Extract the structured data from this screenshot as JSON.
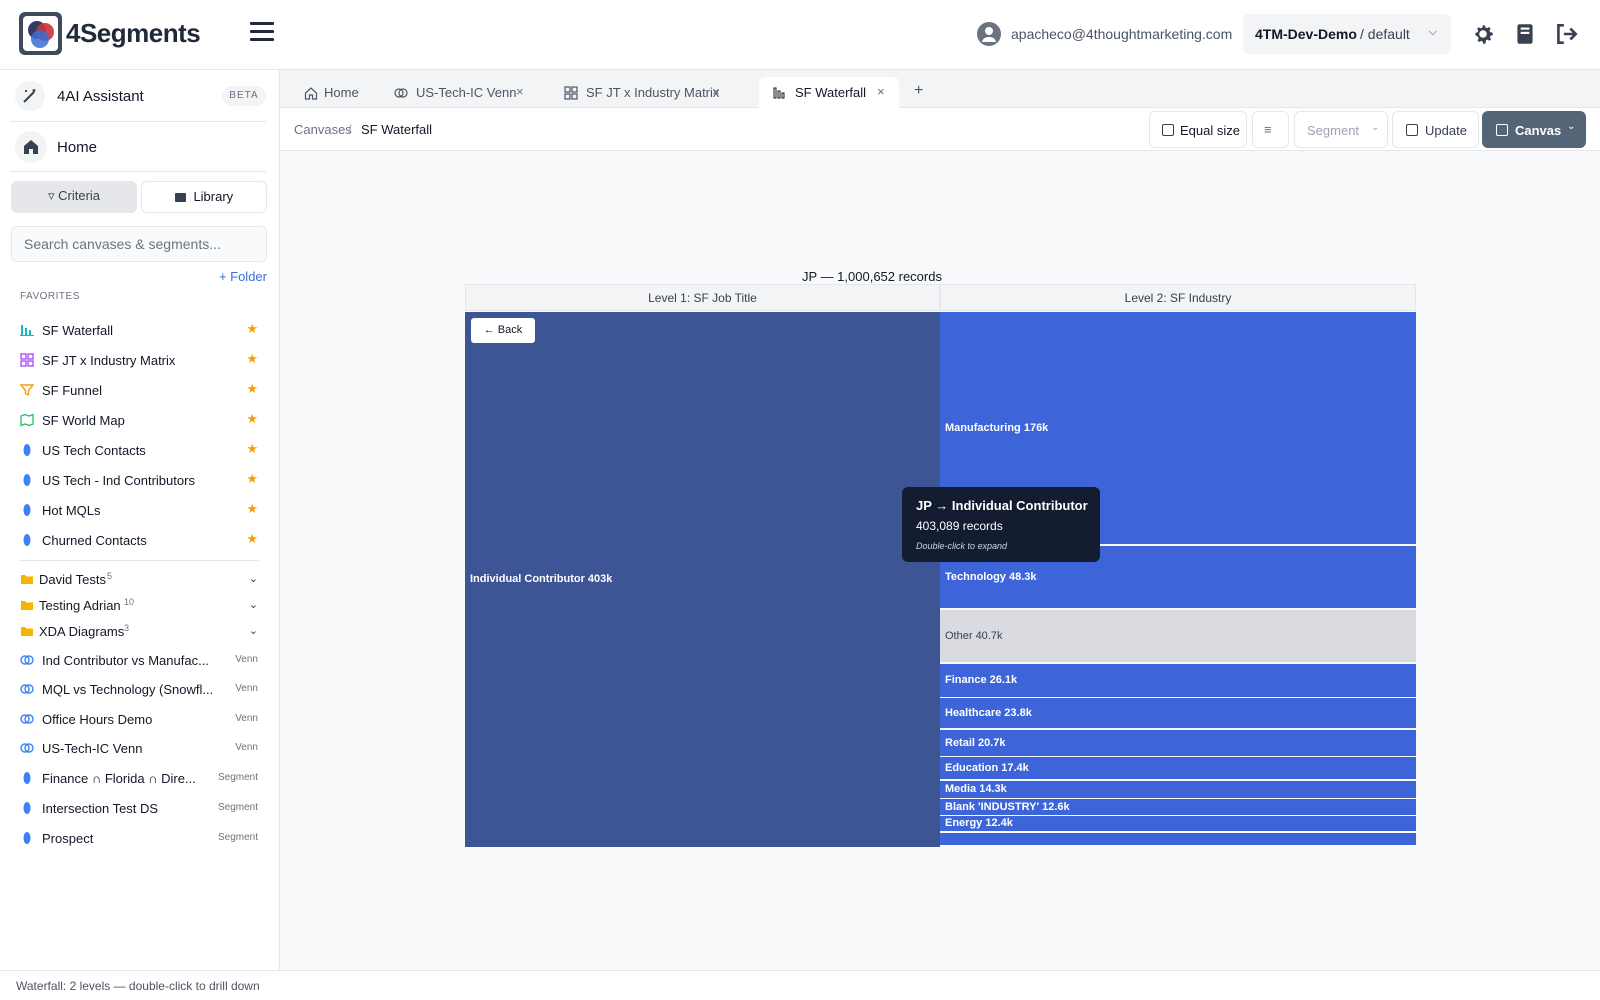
{
  "app": {
    "name": "4Segments"
  },
  "header": {
    "user_email": "apacheco@4thoughtmarketing.com",
    "org_name": "4TM-Dev-Demo",
    "org_sub": "/ default"
  },
  "sidebar": {
    "ai_label": "4AI Assistant",
    "ai_badge": "BETA",
    "home_label": "Home",
    "criteria_label": "Criteria",
    "library_label": "Library",
    "search_placeholder": "Search canvases & segments...",
    "add_folder": "+ Folder",
    "favorites_heading": "FAVORITES",
    "favorites": [
      {
        "label": "SF Waterfall",
        "icon": "waterfall-icon"
      },
      {
        "label": "SF JT x Industry Matrix",
        "icon": "matrix-icon"
      },
      {
        "label": "SF Funnel",
        "icon": "funnel-icon"
      },
      {
        "label": "SF World Map",
        "icon": "map-icon"
      },
      {
        "label": "US Tech Contacts",
        "icon": "segment-icon"
      },
      {
        "label": "US Tech - Ind Contributors",
        "icon": "segment-icon"
      },
      {
        "label": "Hot MQLs",
        "icon": "segment-icon"
      },
      {
        "label": "Churned Contacts",
        "icon": "segment-icon"
      }
    ],
    "folders": [
      {
        "label": "David Tests",
        "count": "5"
      },
      {
        "label": "Testing Adrian",
        "count": "10"
      },
      {
        "label": "XDA Diagrams",
        "count": "3"
      }
    ],
    "items": [
      {
        "label": "Ind Contributor vs Manufac...",
        "type": "Venn"
      },
      {
        "label": "MQL vs Technology (Snowfl...",
        "type": "Venn"
      },
      {
        "label": "Office Hours Demo",
        "type": "Venn"
      },
      {
        "label": "US-Tech-IC Venn",
        "type": "Venn"
      },
      {
        "label": "Finance ∩ Florida ∩ Dire...",
        "type": "Segment"
      },
      {
        "label": "Intersection Test DS",
        "type": "Segment"
      },
      {
        "label": "Prospect",
        "type": "Segment"
      }
    ]
  },
  "tabs": [
    {
      "label": "Home"
    },
    {
      "label": "US-Tech-IC Venn"
    },
    {
      "label": "SF JT x Industry Matrix"
    },
    {
      "label": "SF Waterfall"
    }
  ],
  "add_tab": "+",
  "breadcrumb": {
    "root": "Canvases",
    "sep": "/",
    "current": "SF Waterfall"
  },
  "toolbar": {
    "equal_size": "Equal size",
    "segment": "Segment",
    "update": "Update",
    "canvas": "Canvas"
  },
  "chart_data": {
    "type": "waterfall",
    "title": "JP — 1,000,652 records",
    "total": 1000652,
    "levels": [
      "Level 1: SF Job Title",
      "Level 2: SF Industry"
    ],
    "level1": [
      {
        "label": "Individual Contributor 403k",
        "value": 403089
      }
    ],
    "level2": [
      {
        "label": "Manufacturing 176k",
        "value": 176000
      },
      {
        "label": "Technology 48.3k",
        "value": 48300
      },
      {
        "label": "Other 40.7k",
        "value": 40700
      },
      {
        "label": "Finance 26.1k",
        "value": 26100
      },
      {
        "label": "Healthcare 23.8k",
        "value": 23800
      },
      {
        "label": "Retail 20.7k",
        "value": 20700
      },
      {
        "label": "Education 17.4k",
        "value": 17400
      },
      {
        "label": "Media 14.3k",
        "value": 14300
      },
      {
        "label": "Blank 'INDUSTRY' 12.6k",
        "value": 12600
      },
      {
        "label": "Energy 12.4k",
        "value": 12400
      },
      {
        "label": "",
        "value": 10789
      }
    ],
    "colors": {
      "level1": "#3d5595",
      "level2": "#3d65d9",
      "other": "#d9dbe0"
    },
    "back_label": "← Back",
    "tooltip": {
      "title": "JP → Individual Contributor",
      "records": "403,089 records",
      "hint": "Double-click to expand"
    }
  },
  "status": "Waterfall: 2 levels — double-click to drill down"
}
